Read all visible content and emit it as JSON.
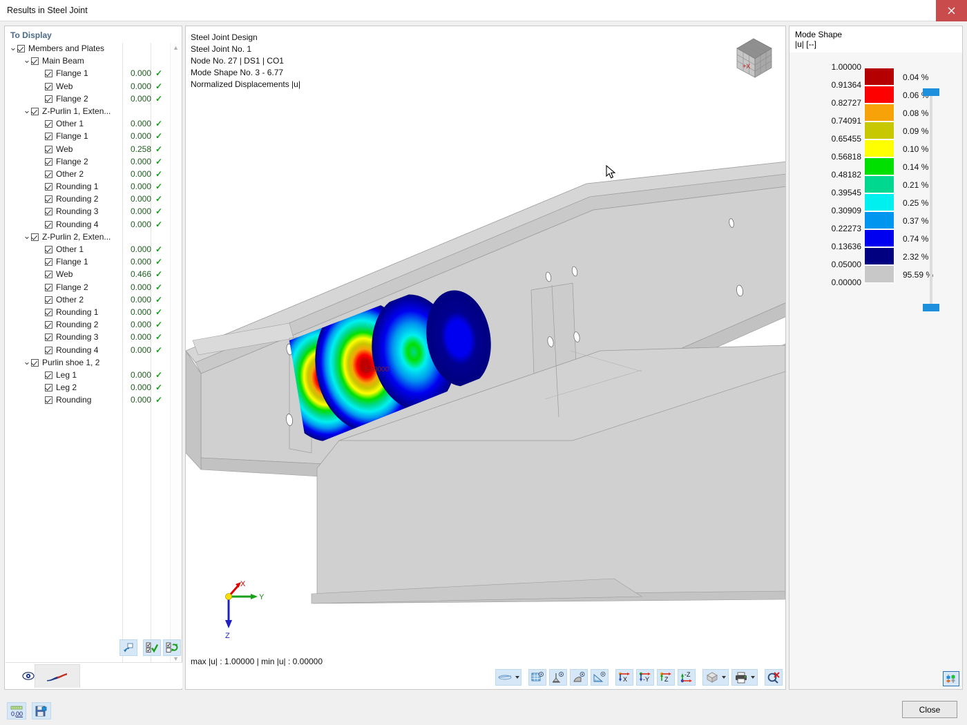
{
  "window": {
    "title": "Results in Steel Joint",
    "close_icon": "close-icon"
  },
  "left_panel": {
    "header": "To Display",
    "tree": [
      {
        "label": "Members and Plates",
        "depth": 0,
        "chevron": true,
        "checked": true,
        "value": "",
        "ok": false
      },
      {
        "label": "Main Beam",
        "depth": 1,
        "chevron": true,
        "checked": true,
        "value": "",
        "ok": false
      },
      {
        "label": "Flange 1",
        "depth": 2,
        "chevron": false,
        "checked": true,
        "value": "0.000",
        "ok": true
      },
      {
        "label": "Web",
        "depth": 2,
        "chevron": false,
        "checked": true,
        "value": "0.000",
        "ok": true
      },
      {
        "label": "Flange 2",
        "depth": 2,
        "chevron": false,
        "checked": true,
        "value": "0.000",
        "ok": true
      },
      {
        "label": "Z-Purlin 1, Exten...",
        "depth": 1,
        "chevron": true,
        "checked": true,
        "value": "",
        "ok": false
      },
      {
        "label": "Other 1",
        "depth": 2,
        "chevron": false,
        "checked": true,
        "value": "0.000",
        "ok": true
      },
      {
        "label": "Flange 1",
        "depth": 2,
        "chevron": false,
        "checked": true,
        "value": "0.000",
        "ok": true
      },
      {
        "label": "Web",
        "depth": 2,
        "chevron": false,
        "checked": true,
        "value": "0.258",
        "ok": true
      },
      {
        "label": "Flange 2",
        "depth": 2,
        "chevron": false,
        "checked": true,
        "value": "0.000",
        "ok": true
      },
      {
        "label": "Other 2",
        "depth": 2,
        "chevron": false,
        "checked": true,
        "value": "0.000",
        "ok": true
      },
      {
        "label": "Rounding 1",
        "depth": 2,
        "chevron": false,
        "checked": true,
        "value": "0.000",
        "ok": true
      },
      {
        "label": "Rounding 2",
        "depth": 2,
        "chevron": false,
        "checked": true,
        "value": "0.000",
        "ok": true
      },
      {
        "label": "Rounding 3",
        "depth": 2,
        "chevron": false,
        "checked": true,
        "value": "0.000",
        "ok": true
      },
      {
        "label": "Rounding 4",
        "depth": 2,
        "chevron": false,
        "checked": true,
        "value": "0.000",
        "ok": true
      },
      {
        "label": "Z-Purlin 2, Exten...",
        "depth": 1,
        "chevron": true,
        "checked": true,
        "value": "",
        "ok": false
      },
      {
        "label": "Other 1",
        "depth": 2,
        "chevron": false,
        "checked": true,
        "value": "0.000",
        "ok": true
      },
      {
        "label": "Flange 1",
        "depth": 2,
        "chevron": false,
        "checked": true,
        "value": "0.000",
        "ok": true
      },
      {
        "label": "Web",
        "depth": 2,
        "chevron": false,
        "checked": true,
        "value": "0.466",
        "ok": true
      },
      {
        "label": "Flange 2",
        "depth": 2,
        "chevron": false,
        "checked": true,
        "value": "0.000",
        "ok": true
      },
      {
        "label": "Other 2",
        "depth": 2,
        "chevron": false,
        "checked": true,
        "value": "0.000",
        "ok": true
      },
      {
        "label": "Rounding 1",
        "depth": 2,
        "chevron": false,
        "checked": true,
        "value": "0.000",
        "ok": true
      },
      {
        "label": "Rounding 2",
        "depth": 2,
        "chevron": false,
        "checked": true,
        "value": "0.000",
        "ok": true
      },
      {
        "label": "Rounding 3",
        "depth": 2,
        "chevron": false,
        "checked": true,
        "value": "0.000",
        "ok": true
      },
      {
        "label": "Rounding 4",
        "depth": 2,
        "chevron": false,
        "checked": true,
        "value": "0.000",
        "ok": true
      },
      {
        "label": "Purlin shoe 1, 2",
        "depth": 1,
        "chevron": true,
        "checked": true,
        "value": "",
        "ok": false
      },
      {
        "label": "Leg 1",
        "depth": 2,
        "chevron": false,
        "checked": true,
        "value": "0.000",
        "ok": true
      },
      {
        "label": "Leg 2",
        "depth": 2,
        "chevron": false,
        "checked": true,
        "value": "0.000",
        "ok": true
      },
      {
        "label": "Rounding",
        "depth": 2,
        "chevron": false,
        "checked": true,
        "value": "0.000",
        "ok": true
      }
    ],
    "tool_buttons": [
      {
        "name": "restore-default-button",
        "icon": "restore-icon"
      },
      {
        "name": "select-all-button",
        "icon": "check-all-icon"
      },
      {
        "name": "invert-selection-button",
        "icon": "invert-selection-icon"
      }
    ],
    "tabs": [
      {
        "name": "tab-visibility",
        "icon": "eye-icon",
        "active": false
      },
      {
        "name": "tab-deformation",
        "icon": "deformation-icon",
        "active": true
      }
    ]
  },
  "view": {
    "title_lines": [
      "Steel Joint Design",
      "Steel Joint No. 1",
      "Node No. 27 | DS1 | CO1",
      "Mode Shape No. 3 - 6.77",
      "Normalized Displacements |u|"
    ],
    "status": "max |u| : 1.00000 | min |u| : 0.00000",
    "max_label": "1.00000",
    "axes": {
      "x": "X",
      "y": "Y",
      "z": "Z"
    },
    "viewcube_label": "+X",
    "toolbar": [
      {
        "name": "render-mode-button",
        "icon": "render-icon",
        "dropdown": true
      },
      {
        "name": "grid-button",
        "icon": "grid-icon",
        "dropdown": false
      },
      {
        "name": "supports-button",
        "icon": "support-icon",
        "dropdown": false
      },
      {
        "name": "loads-button",
        "icon": "load-icon",
        "dropdown": false
      },
      {
        "name": "measure-button",
        "icon": "ruler-icon",
        "dropdown": false
      },
      {
        "name": "view-in-x-button",
        "icon": "axis-x-icon",
        "dropdown": false
      },
      {
        "name": "view-in-y-button",
        "icon": "axis-y-icon",
        "dropdown": false
      },
      {
        "name": "view-in-z-button",
        "icon": "axis-z-icon",
        "dropdown": false
      },
      {
        "name": "view-in-minus-z-button",
        "icon": "axis-minus-z-icon",
        "dropdown": false
      },
      {
        "name": "isometric-view-button",
        "icon": "cube-icon",
        "dropdown": true
      },
      {
        "name": "print-button",
        "icon": "printer-icon",
        "dropdown": true
      },
      {
        "name": "clear-selection-button",
        "icon": "deselect-icon",
        "dropdown": false
      }
    ]
  },
  "legend": {
    "title": "Mode Shape",
    "subtitle": "|u| [--]",
    "values": [
      "1.00000",
      "0.91364",
      "0.82727",
      "0.74091",
      "0.65455",
      "0.56818",
      "0.48182",
      "0.39545",
      "0.30909",
      "0.22273",
      "0.13636",
      "0.05000",
      "0.00000"
    ],
    "bands": [
      {
        "color": "#b40000",
        "percent": "0.04 %"
      },
      {
        "color": "#ff0000",
        "percent": "0.06 %"
      },
      {
        "color": "#f6a208",
        "percent": "0.08 %"
      },
      {
        "color": "#c8c800",
        "percent": "0.09 %"
      },
      {
        "color": "#ffff00",
        "percent": "0.10 %"
      },
      {
        "color": "#00e000",
        "percent": "0.14 %"
      },
      {
        "color": "#00d890",
        "percent": "0.21 %"
      },
      {
        "color": "#00f0f0",
        "percent": "0.25 %"
      },
      {
        "color": "#0096f0",
        "percent": "0.37 %"
      },
      {
        "color": "#0000f0",
        "percent": "0.74 %"
      },
      {
        "color": "#000080",
        "percent": "2.32 %"
      },
      {
        "color": "#c8c8c8",
        "percent": "95.59 %"
      }
    ],
    "slider_color": "#1e8fdc",
    "corner_button": {
      "name": "legend-settings-button",
      "icon": "sliders-icon"
    }
  },
  "footer": {
    "buttons": [
      {
        "name": "units-button",
        "icon": "units-icon"
      },
      {
        "name": "settings-button",
        "icon": "save-config-icon"
      }
    ],
    "close_label": "Close"
  }
}
